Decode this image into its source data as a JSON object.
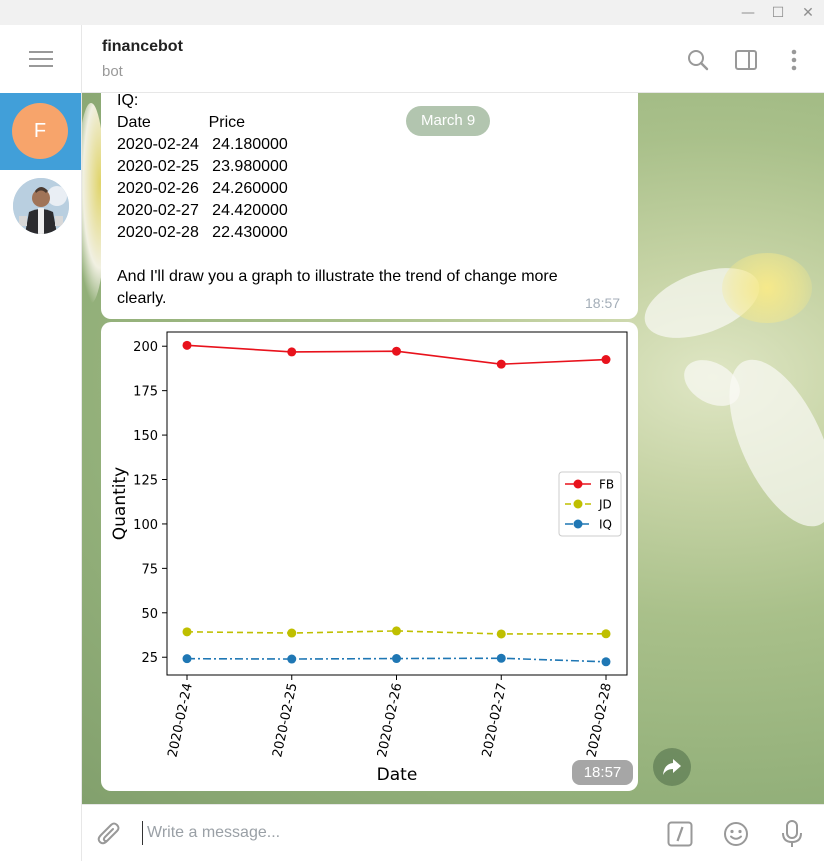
{
  "window": {
    "minimize": "—",
    "maximize": "☐",
    "close": "✕"
  },
  "sidebar": {
    "avatar_letter": "F",
    "active_color": "#419fd9"
  },
  "header": {
    "title": "financebot",
    "subtitle": "bot"
  },
  "chat": {
    "date_pill": "March 9",
    "message1": {
      "lines": [
        "IQ:",
        "Date             Price",
        "2020-02-24   24.180000",
        "2020-02-25   23.980000",
        "2020-02-26   24.260000",
        "2020-02-27   24.420000",
        "2020-02-28   22.430000",
        "",
        "And I'll draw you a graph to illustrate the trend of change more",
        "clearly."
      ],
      "time": "18:57"
    },
    "message2": {
      "time": "18:57"
    }
  },
  "composer": {
    "placeholder": "Write a message...",
    "command_icon": "/"
  },
  "chart_data": {
    "type": "line",
    "categories": [
      "2020-02-24",
      "2020-02-25",
      "2020-02-26",
      "2020-02-27",
      "2020-02-28"
    ],
    "series": [
      {
        "name": "FB",
        "values": [
          200.5,
          196.8,
          197.2,
          189.9,
          192.5
        ],
        "color": "#e8121c",
        "style": "solid"
      },
      {
        "name": "JD",
        "values": [
          39.3,
          38.6,
          39.8,
          38.1,
          38.2
        ],
        "color": "#bfbf00",
        "style": "dashed"
      },
      {
        "name": "IQ",
        "values": [
          24.18,
          23.98,
          24.26,
          24.42,
          22.43
        ],
        "color": "#1f77b4",
        "style": "dashdot"
      }
    ],
    "xlabel": "Date",
    "ylabel": "Quantity",
    "yticks": [
      25,
      50,
      75,
      100,
      125,
      150,
      175,
      200
    ],
    "ylim": [
      15,
      208
    ],
    "legend_position": "center-right",
    "grid": false
  }
}
